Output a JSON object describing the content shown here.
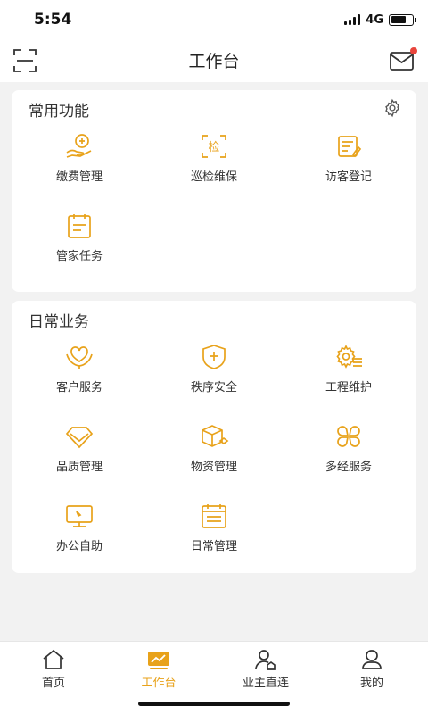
{
  "status": {
    "time": "5:54",
    "network": "4G",
    "battery_level": 0.7
  },
  "header": {
    "title": "工作台",
    "scan_icon": "scan-icon",
    "mail_icon": "mail-icon",
    "has_unread": true
  },
  "sections": [
    {
      "title": "常用功能",
      "settings_icon": "gear-icon",
      "items": [
        {
          "label": "缴费管理",
          "icon": "payment-icon"
        },
        {
          "label": "巡检维保",
          "icon": "inspection-icon"
        },
        {
          "label": "访客登记",
          "icon": "visitor-register-icon"
        },
        {
          "label": "管家任务",
          "icon": "task-clipboard-icon"
        }
      ]
    },
    {
      "title": "日常业务",
      "items": [
        {
          "label": "客户服务",
          "icon": "heart-hand-icon"
        },
        {
          "label": "秩序安全",
          "icon": "shield-icon"
        },
        {
          "label": "工程维护",
          "icon": "gear-list-icon"
        },
        {
          "label": "品质管理",
          "icon": "diamond-icon"
        },
        {
          "label": "物资管理",
          "icon": "box-icon"
        },
        {
          "label": "多经服务",
          "icon": "clover-icon"
        },
        {
          "label": "办公自助",
          "icon": "monitor-icon"
        },
        {
          "label": "日常管理",
          "icon": "calendar-list-icon"
        }
      ]
    }
  ],
  "tabs": [
    {
      "label": "首页",
      "icon": "home-icon",
      "active": false
    },
    {
      "label": "工作台",
      "icon": "workbench-chart-icon",
      "active": true
    },
    {
      "label": "业主直连",
      "icon": "owner-contact-icon",
      "active": false
    },
    {
      "label": "我的",
      "icon": "profile-icon",
      "active": false
    }
  ],
  "colors": {
    "accent": "#e8a21a",
    "icon_gold": "#e8a21a",
    "background": "#f2f2f2",
    "badge": "#e8453c"
  }
}
